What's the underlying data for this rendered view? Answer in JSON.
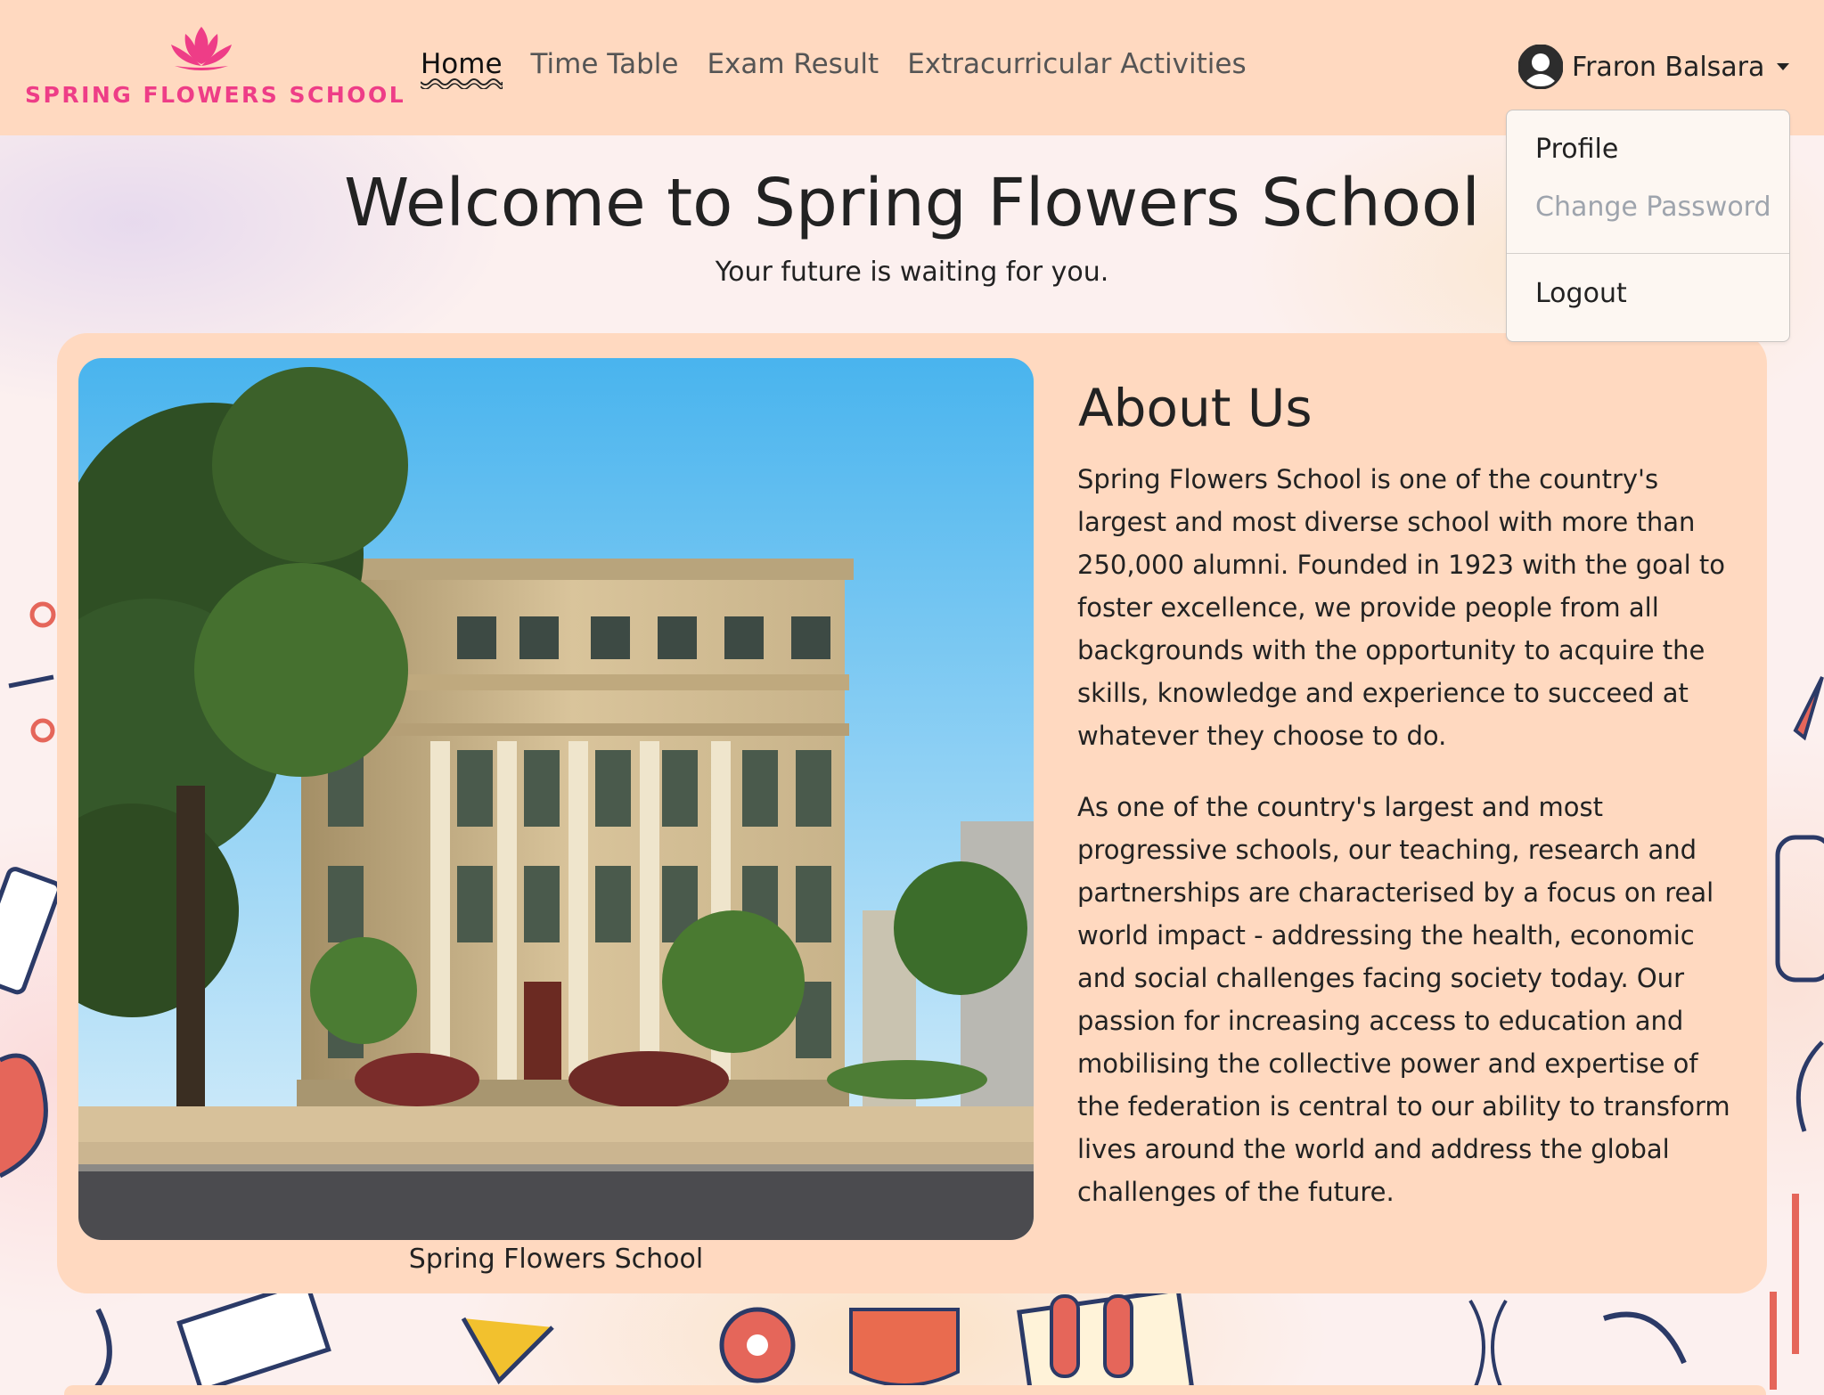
{
  "brand": {
    "name": "SPRING FLOWERS SCHOOL",
    "logo_icon": "lotus-icon",
    "color": "#ee3d87"
  },
  "nav": {
    "links": [
      {
        "label": "Home",
        "active": true
      },
      {
        "label": "Time Table",
        "active": false
      },
      {
        "label": "Exam Result",
        "active": false
      },
      {
        "label": "Extracurricular Activities",
        "active": false
      }
    ]
  },
  "user": {
    "name": "Fraron Balsara",
    "avatar_icon": "user-avatar-icon",
    "menu": {
      "profile": "Profile",
      "change_password": "Change Password",
      "logout": "Logout"
    }
  },
  "hero": {
    "title": "Welcome to Spring Flowers School",
    "subtitle": "Your future is waiting for you."
  },
  "about": {
    "image_caption": "Spring Flowers School",
    "title": "About Us",
    "paragraphs": [
      "Spring Flowers School is one of the country's largest and most diverse school with more than 250,000 alumni. Founded in 1923 with the goal to foster excellence, we provide people from all backgrounds with the opportunity to acquire the skills, knowledge and experience to succeed at whatever they choose to do.",
      "As one of the country's largest and most progressive schools, our teaching, research and partnerships are characterised by a focus on real world impact - addressing the health, economic and social challenges facing society today. Our passion for increasing access to education and mobilising the collective power and expertise of the federation is central to our ability to transform lives around the world and address the global challenges of the future."
    ]
  },
  "colors": {
    "navbar": "#ffd9c0",
    "card": "#ffd9c0",
    "page_background": "#fcf0ef"
  }
}
